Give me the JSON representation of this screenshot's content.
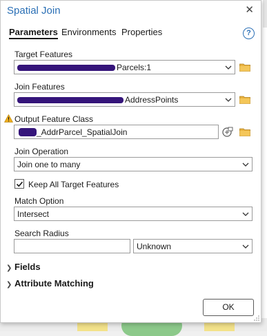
{
  "dialog": {
    "title": "Spatial Join",
    "close_glyph": "✕"
  },
  "tabs": [
    {
      "label": "Parameters",
      "active": true
    },
    {
      "label": "Environments",
      "active": false
    },
    {
      "label": "Properties",
      "active": false
    }
  ],
  "help_glyph": "?",
  "target_features": {
    "label": "Target Features",
    "value": "Parcels:1"
  },
  "join_features": {
    "label": "Join Features",
    "value": "AddressPoints"
  },
  "output_feature_class": {
    "label": "Output Feature Class",
    "value": "_AddrParcel_SpatialJoin"
  },
  "join_operation": {
    "label": "Join Operation",
    "value": "Join one to many"
  },
  "keep_all_target": {
    "label": "Keep All Target Features",
    "checked": true
  },
  "match_option": {
    "label": "Match Option",
    "value": "Intersect"
  },
  "search_radius": {
    "label": "Search Radius",
    "value": "",
    "unit": "Unknown"
  },
  "sections": {
    "fields": "Fields",
    "attribute_matching": "Attribute Matching"
  },
  "ok_label": "OK",
  "icons": {
    "folder": "folder-icon",
    "warning": "warning-icon",
    "database": "database-icon",
    "chevron": "chevron-down-icon",
    "expand": "chevron-right-icon"
  },
  "colors": {
    "accent": "#2a6fb5",
    "folder": "#e9b23f",
    "warning": "#f2b01e"
  }
}
